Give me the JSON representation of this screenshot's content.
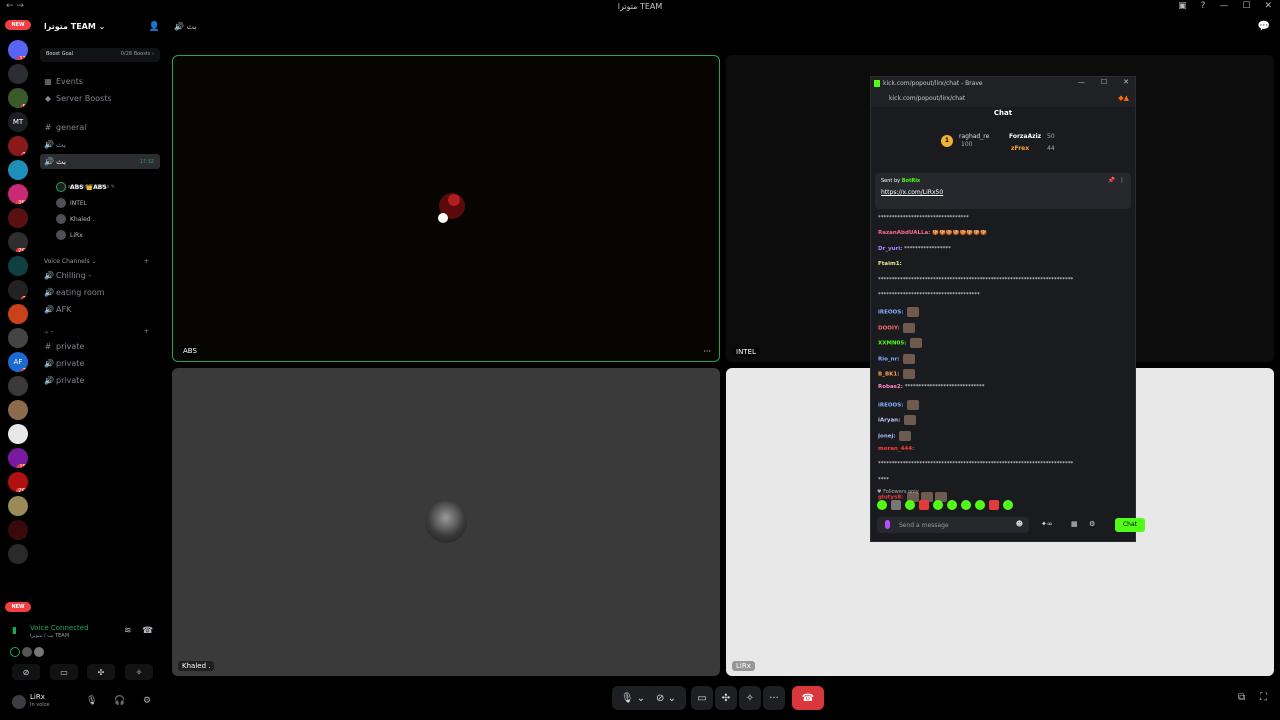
{
  "window": {
    "title": "متوترا TEAM",
    "nav": "← →",
    "controls": [
      "▣",
      "?",
      "—",
      "☐",
      "✕"
    ]
  },
  "rail": {
    "new_label": "NEW",
    "servers": [
      {
        "badge": "116",
        "color": "#5865f2",
        "letters": ""
      },
      {
        "badge": "",
        "color": "#2b2d31",
        "letters": ""
      },
      {
        "badge": "51",
        "color": "#3a5a2b",
        "letters": ""
      },
      {
        "badge": "",
        "color": "#1e1f22",
        "letters": "MT"
      },
      {
        "badge": "19",
        "color": "#8a1a1a",
        "letters": ""
      },
      {
        "badge": "",
        "color": "#1d8fb8",
        "letters": ""
      },
      {
        "badge": "3K+",
        "color": "#c92a76",
        "letters": ""
      },
      {
        "badge": "",
        "color": "#5a1010",
        "letters": ""
      },
      {
        "badge": "2K+",
        "color": "#2e2e2e",
        "letters": ""
      },
      {
        "badge": "9",
        "color": "#0f3f40",
        "letters": ""
      },
      {
        "badge": "26",
        "color": "#222",
        "letters": ""
      },
      {
        "badge": "",
        "color": "#c9421b",
        "letters": ""
      },
      {
        "badge": "",
        "color": "#444",
        "letters": ""
      },
      {
        "badge": "74",
        "color": "#1a6ad1",
        "letters": "AF"
      },
      {
        "badge": "",
        "color": "#3a3a3a",
        "letters": ""
      },
      {
        "badge": "",
        "color": "#8c6a4e",
        "letters": ""
      },
      {
        "badge": "",
        "color": "#e8e8e8",
        "letters": ""
      },
      {
        "badge": "153",
        "color": "#7a1aa0",
        "letters": ""
      },
      {
        "badge": "2K+",
        "color": "#b01010",
        "letters": ""
      },
      {
        "badge": "",
        "color": "#9a8a5a",
        "letters": ""
      },
      {
        "badge": "9",
        "color": "#3a0a0a",
        "letters": ""
      },
      {
        "badge": "",
        "color": "#2a2a2a",
        "letters": ""
      }
    ],
    "new_bottom": "NEW"
  },
  "sidebar": {
    "server_name": "متوترا TEAM ⌄",
    "boost_goal": "Boost Goal",
    "boost_count": "0/28 Boosts ›",
    "events": "Events",
    "server_boosts": "Server Boosts",
    "general": "general",
    "voice1": "بث",
    "voice2": "بث",
    "voice2_time": "17:32",
    "set_status": "Set a channel status ✎",
    "users": [
      "ABS 👑ABS",
      "INTEL",
      "Khaled .",
      "LiRx"
    ],
    "category_voice": "Voice Channels ⌄",
    "chilling": "Chilling -",
    "eating": "eating room",
    "afk": "AFK",
    "category_blank": "⌄ -",
    "private1": "private",
    "private2": "private",
    "private3": "private"
  },
  "voice_panel": {
    "title": "Voice Connected",
    "subtitle": "بث / متوترا TEAM"
  },
  "user": {
    "name": "LiRx",
    "status": "In voice"
  },
  "channel_header": {
    "name": "بث"
  },
  "tiles": {
    "abs": "ABS",
    "intel": "INTEL",
    "khaled": "Khaled .",
    "lirx": "LiRx",
    "more": "···"
  },
  "popout": {
    "tab_title": "kick.com/popout/lirx/chat - Brave",
    "url": "kick.com/popout/lirx/chat",
    "chat_header": "Chat",
    "leaders": [
      {
        "name": "raghad_re",
        "count": "100"
      },
      {
        "name": "ForzaAziz",
        "count": "50"
      },
      {
        "name": "zFrex",
        "count": "44"
      }
    ],
    "pinned_by": "Sent by",
    "pinned_bot": "BotRix",
    "pinned_link": "https://x.com/LiRx50",
    "messages": [
      {
        "name": "",
        "color": "#e8e8e8",
        "text": "*********************************",
        "emotes": 0
      },
      {
        "name": "RazanAbdUALLa:",
        "color": "#ff6b8a",
        "text": "🍪🍪🍪🍪🍪🍪🍪🍪",
        "emotes": 0
      },
      {
        "name": "Dr_yuri:",
        "color": "#b48aff",
        "text": "*****************",
        "emotes": 0
      },
      {
        "name": "Ftaim1:",
        "color": "#f0e68c",
        "text": "",
        "emotes": 0
      },
      {
        "name": "",
        "color": "#e8e8e8",
        "text": "***********************************************************************",
        "emotes": 0
      },
      {
        "name": "",
        "color": "#e8e8e8",
        "text": "*************************************",
        "emotes": 0
      },
      {
        "name": "iREOOS:",
        "color": "#8ab4ff",
        "text": "",
        "emotes": 1
      },
      {
        "name": "DOOIY:",
        "color": "#ff6b6b",
        "text": "",
        "emotes": 1
      },
      {
        "name": "XXMN05:",
        "color": "#53fc18",
        "text": "",
        "emotes": 1
      },
      {
        "name": "Rio_nr:",
        "color": "#8ab4ff",
        "text": "",
        "emotes": 1
      },
      {
        "name": "B_BK1:",
        "color": "#ff9f43",
        "text": "",
        "emotes": 1
      },
      {
        "name": "Robas2:",
        "color": "#ff8ac6",
        "text": "*****************************",
        "emotes": 0
      },
      {
        "name": "iREOOS:",
        "color": "#8ab4ff",
        "text": "",
        "emotes": 1
      },
      {
        "name": "iAryan:",
        "color": "#c8c8ff",
        "text": "",
        "emotes": 1
      },
      {
        "name": "Jonej:",
        "color": "#a0c0ff",
        "text": "",
        "emotes": 1
      },
      {
        "name": "moran_444:",
        "color": "#ff3b3b",
        "text": "",
        "emotes": 0
      },
      {
        "name": "",
        "color": "#e8e8e8",
        "text": "***********************************************************************",
        "emotes": 0
      },
      {
        "name": "",
        "color": "#e8e8e8",
        "text": "****",
        "emotes": 0
      },
      {
        "name": "glutys8:",
        "color": "#ff3b3b",
        "text": "",
        "emotes": 3
      }
    ],
    "followers_only": "♥ Followers only",
    "send_placeholder": "Send a message",
    "chat_button": "Chat"
  }
}
